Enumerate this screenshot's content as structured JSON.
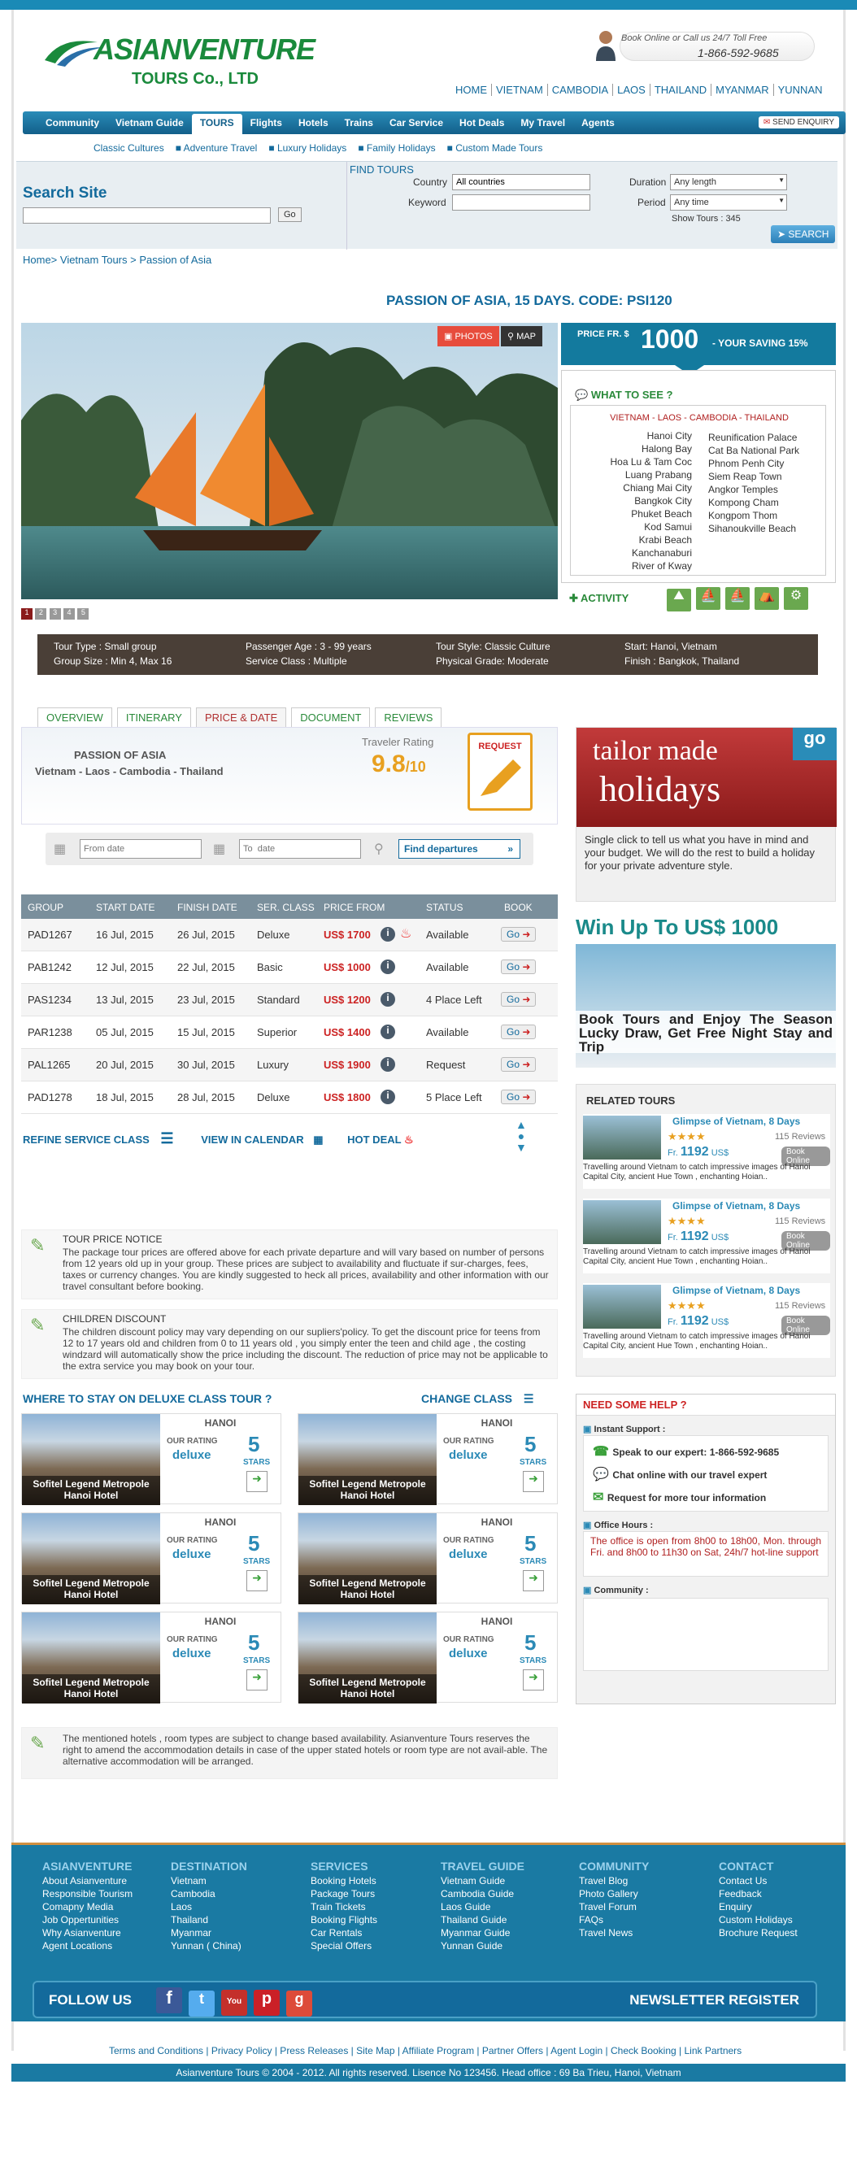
{
  "header": {
    "logo_main": "ASIANVENTURE",
    "logo_sub": "TOURS Co., LTD",
    "call_line1": "Book Online or Call us 24/7 Toll Free",
    "call_phone": "1-866-592-9685",
    "top_links": [
      "HOME",
      "VIETNAM",
      "CAMBODIA",
      "LAOS",
      "THAILAND",
      "MYANMAR",
      "YUNNAN"
    ]
  },
  "nav": {
    "items": [
      "Community",
      "Vietnam Guide",
      "TOURS",
      "Flights",
      "Hotels",
      "Trains",
      "Car Service",
      "Hot Deals",
      "My Travel",
      "Agents"
    ],
    "send_enquiry": "SEND ENQUIRY"
  },
  "subnav": [
    "Classic Cultures",
    "Adventure Travel",
    "Luxury Holidays",
    "Family Holidays",
    "Custom Made Tours"
  ],
  "search": {
    "title": "Search Site",
    "go": "Go",
    "find_tours": "FIND TOURS",
    "country_label": "Country",
    "country_value": "All countries",
    "keyword_label": "Keyword",
    "duration_label": "Duration",
    "duration_value": "Any length",
    "period_label": "Period",
    "period_value": "Any time",
    "show_tours": "Show  Tours : 345",
    "search_btn": "SEARCH"
  },
  "breadcrumb": "Home> Vietnam Tours > Passion of Asia",
  "tour": {
    "title": "PASSION OF ASIA, 15 DAYS. CODE: PSI120",
    "photos": "PHOTOS",
    "map": "MAP",
    "price_prefix": "PRICE FR. $",
    "price": "1000",
    "saving": "YOUR SAVING 15%",
    "what_to_see": "WHAT TO SEE ?",
    "countries": "VIETNAM - LAOS - CAMBODIA - THAILAND",
    "places_left": [
      "Hanoi City",
      "Halong Bay",
      "Hoa Lu  & Tam Coc",
      "Luang Prabang",
      "Chiang Mai City",
      "Bangkok City",
      "Phuket Beach",
      "Kod Samui",
      "Krabi Beach",
      "Kanchanaburi",
      "River of Kway"
    ],
    "places_right": [
      "Reunification Palace",
      "Cat Ba National Park",
      "Phnom Penh City",
      "Siem Reap Town",
      "Angkor Temples",
      "Kompong Cham",
      "Kongpom Thom",
      "Sihanoukville Beach"
    ],
    "activity": "ACTIVITY",
    "slides": [
      "1",
      "2",
      "3",
      "4",
      "5"
    ],
    "info": {
      "tour_type": "Tour Type : Small group",
      "group_size": "Group Size : Min 4, Max 16",
      "age": "Passenger Age : 3 - 99 years",
      "service": "Service Class :  Multiple",
      "style": "Tour Style: Classic Culture",
      "grade": "Physical Grade:  Moderate",
      "start": "Start: Hanoi, Vietnam",
      "finish": "Finish : Bangkok, Thailand"
    }
  },
  "tabs": [
    "OVERVIEW",
    "ITINERARY",
    "PRICE & DATE",
    "DOCUMENT",
    "REVIEWS"
  ],
  "tourbox": {
    "name": "PASSION OF  ASIA",
    "route": "Vietnam - Laos - Cambodia - Thailand",
    "rating_label": "Traveler Rating",
    "rating": "9.8",
    "rating_max": "/10",
    "request": "REQUEST"
  },
  "dates": {
    "from_placeholder": "From date",
    "to_placeholder": "To  date",
    "find": "Find departures"
  },
  "departures": {
    "headers": [
      "GROUP",
      "START DATE",
      "FINISH DATE",
      "SER. CLASS",
      "PRICE FROM",
      "STATUS",
      "BOOK"
    ],
    "rows": [
      {
        "group": "PAD1267",
        "start": "16 Jul, 2015",
        "finish": "26 Jul, 2015",
        "class": "Deluxe",
        "price": "US$ 1700",
        "status": "Available",
        "book": "Go",
        "hot": true
      },
      {
        "group": "PAB1242",
        "start": "12 Jul, 2015",
        "finish": "22 Jul, 2015",
        "class": "Basic",
        "price": "US$ 1000",
        "status": "Available",
        "book": "Go",
        "hot": false
      },
      {
        "group": "PAS1234",
        "start": "13 Jul, 2015",
        "finish": "23 Jul, 2015",
        "class": "Standard",
        "price": "US$ 1200",
        "status": "4 Place Left",
        "book": "Go",
        "hot": false
      },
      {
        "group": "PAR1238",
        "start": "05 Jul, 2015",
        "finish": "15 Jul, 2015",
        "class": "Superior",
        "price": "US$ 1400",
        "status": "Available",
        "book": "Go",
        "hot": false
      },
      {
        "group": "PAL1265",
        "start": "20 Jul, 2015",
        "finish": "30 Jul, 2015",
        "class": "Luxury",
        "price": "US$ 1900",
        "status": "Request",
        "book": "Go",
        "hot": false
      },
      {
        "group": "PAD1278",
        "start": "18 Jul, 2015",
        "finish": "28 Jul, 2015",
        "class": "Deluxe",
        "price": "US$ 1800",
        "status": "5 Place Left",
        "book": "Go",
        "hot": false
      }
    ],
    "refine": "REFINE SERVICE CLASS",
    "calendar": "VIEW IN CALENDAR",
    "hotdeal": "HOT DEAL"
  },
  "notes": {
    "price_title": "TOUR PRICE NOTICE",
    "price_text": "The  package tour  prices are offered above for each private departure  and will vary based on number of persons from 12 years old up in your group. These prices  are subject to availability and fluctuate  if sur-charges, fees, taxes or currency changes. You are kindly suggested to heck all prices, availability and other information with our travel consultant before booking.",
    "child_title": "CHILDREN DISCOUNT",
    "child_text": "The children discount policy may  vary depending on our supliers'policy. To get the discount price for teens from  12 to 17 years old  and children from  0 to 11 years old , you simply enter the teen and child age , the costing windzard will automatically show the price including the discount.  The reduction of price may not be applicable to  the extra service you may book on your tour.",
    "hotel_text": "The  mentioned hotels , room types are subject to change based availability.  Asianventure Tours reserves the right to amend the accommodation details in case of the upper stated hotels or room type are not avail-able. The alternative accommodation will be arranged."
  },
  "stay": {
    "title": "WHERE TO STAY ON  DELUXE CLASS TOUR ?",
    "change": "CHANGE CLASS",
    "hotel": {
      "city": "HANOI",
      "name": "Sofitel Legend Metropole Hanoi Hotel",
      "rating_label": "OUR RATING",
      "rating": "deluxe",
      "stars": "5",
      "stars_label": "STARS"
    }
  },
  "right": {
    "tailor_title1": "tailor made",
    "tailor_title2": "holidays",
    "go": "go",
    "tailor_text": "Single click to tell us what you have in mind and your budget. We will do the rest to build a holiday for your private adventure style.",
    "win_title": "Win Up To US$ 1000",
    "win_text": "Book Tours and Enjoy The Season Lucky Draw,  Get Free Night Stay and Trip",
    "related_title": "RELATED TOURS",
    "related": {
      "name": "Glimpse of Vietnam, 8 Days",
      "reviews": "115 Reviews",
      "fr": "Fr.",
      "price": "1192",
      "cur": "US$",
      "book": "Book Online",
      "desc": "Travelling around Vietnam to catch impressive images of Hanoi Capital City, ancient Hue Town , enchanting Hoian.."
    },
    "help_title": "NEED SOME HELP ?",
    "instant": "Instant Support :",
    "speak": "Speak to our expert: 1-866-592-9685",
    "chat": "Chat online with our travel expert",
    "req": "Request  for more tour  information",
    "office_title": "Office Hours :",
    "office_text": "The  office   is  open  from  8h00  to  18h00,  Mon. through Fri. and 8h00 to 11h30 on  Sat,  24h/7 hot-line  support",
    "community": "Community :"
  },
  "footer": {
    "cols": [
      {
        "title": "ASIANVENTURE",
        "items": [
          "About Asianventure",
          "Responsible Tourism",
          "Comapny Media",
          "Job Oppertunities",
          "Why Asianventure",
          "Agent Locations"
        ]
      },
      {
        "title": "DESTINATION",
        "items": [
          "Vietnam",
          "Cambodia",
          "Laos",
          "Thailand",
          "Myanmar",
          "Yunnan ( China)"
        ]
      },
      {
        "title": "SERVICES",
        "items": [
          "Booking Hotels",
          "Package Tours",
          "Train Tickets",
          "Booking Flights",
          "Car Rentals",
          "Special Offers"
        ]
      },
      {
        "title": "TRAVEL GUIDE",
        "items": [
          "Vietnam Guide",
          "Cambodia Guide",
          "Laos Guide",
          "Thailand Guide",
          "Myanmar Guide",
          "Yunnan Guide"
        ]
      },
      {
        "title": "COMMUNITY",
        "items": [
          "Travel Blog",
          "Photo Gallery",
          "Travel Forum",
          "FAQs",
          "Travel News"
        ]
      },
      {
        "title": "CONTACT",
        "items": [
          "Contact Us",
          "Feedback",
          "Enquiry",
          "Custom Holidays",
          "Brochure Request"
        ]
      }
    ],
    "follow": "FOLLOW US",
    "newsletter": "NEWSLETTER REGISTER",
    "links": "Terms  and Conditions | Privacy Policy |  Press Releases | Site Map |  Affiliate Program  | Partner Offers  | Agent Login | Check Booking  | Link Partners",
    "copyright": "Asianventure Tours © 2004 - 2012. All rights reserved. Lisence No   123456. Head office : 69 Ba Trieu, Hanoi, Vietnam"
  }
}
